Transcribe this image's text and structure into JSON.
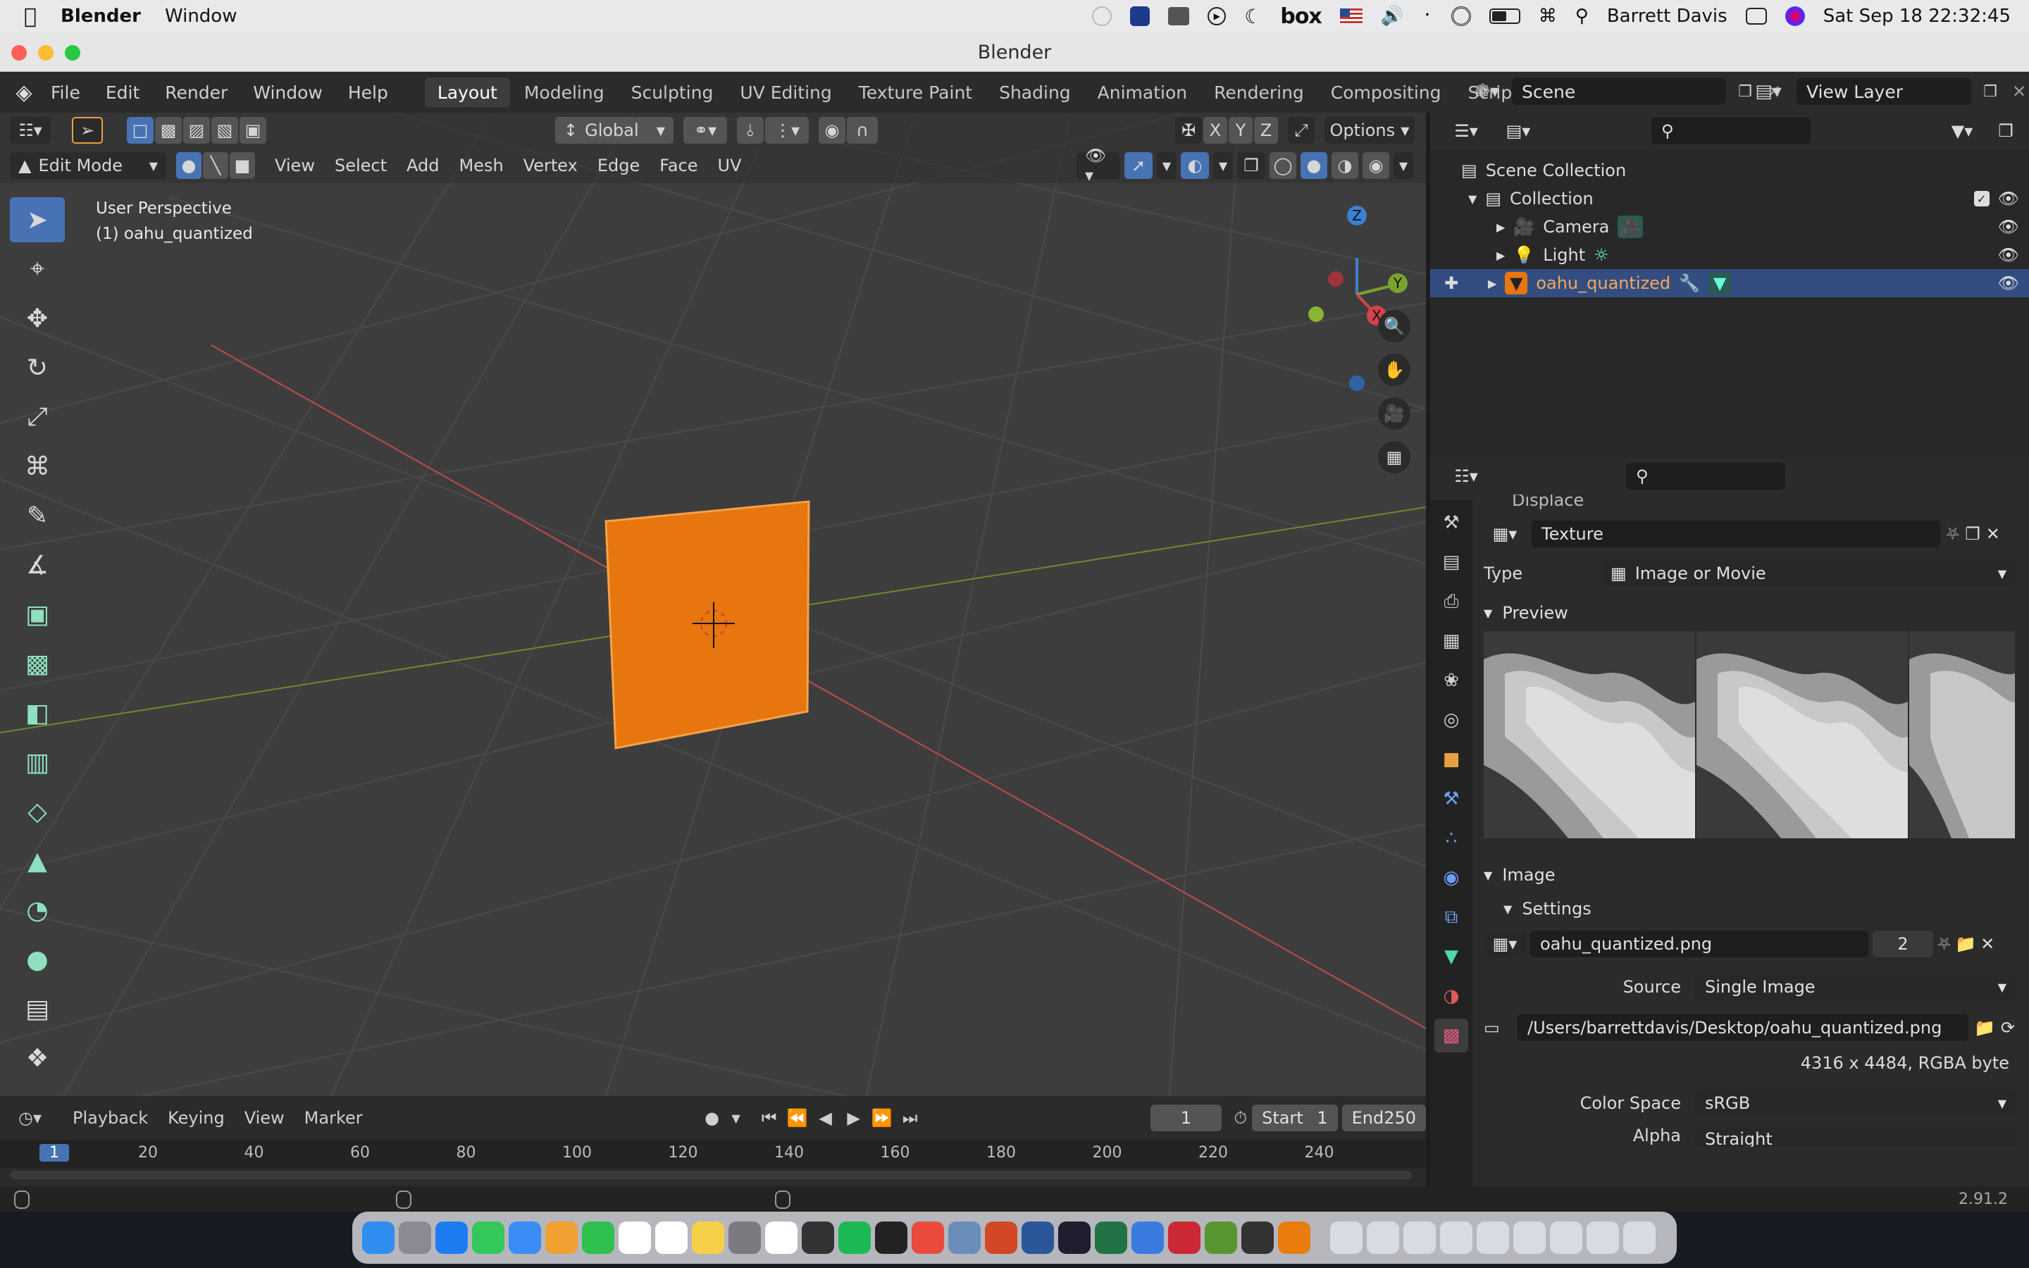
{
  "macos_menubar": {
    "app_name": "Blender",
    "menu_window": "Window",
    "status_icons": [
      "creative-cloud-icon",
      "dropbox-icon",
      "backup-icon",
      "media-play-icon",
      "moon-icon",
      "box-icon",
      "us-flag-icon",
      "volume-icon",
      "bluetooth-icon",
      "airdrop-icon",
      "battery-icon",
      "wifi-icon",
      "spotlight-icon"
    ],
    "box_label": "box",
    "user_name": "Barrett Davis",
    "datetime": "Sat Sep 18  22:32:45"
  },
  "window": {
    "title": "Blender"
  },
  "topbar": {
    "menus": [
      "File",
      "Edit",
      "Render",
      "Window",
      "Help"
    ],
    "workspaces": [
      "Layout",
      "Modeling",
      "Sculpting",
      "UV Editing",
      "Texture Paint",
      "Shading",
      "Animation",
      "Rendering",
      "Compositing",
      "Scripting"
    ],
    "active_workspace": "Layout",
    "add_workspace": "+",
    "scene": "Scene",
    "view_layer": "View Layer"
  },
  "viewport": {
    "header1": {
      "orientation": "Global",
      "axes": [
        "X",
        "Y",
        "Z"
      ],
      "options": "Options"
    },
    "header2": {
      "mode": "Edit Mode",
      "menus": [
        "View",
        "Select",
        "Add",
        "Mesh",
        "Vertex",
        "Edge",
        "Face",
        "UV"
      ]
    },
    "overlay_text": {
      "view_name": "User Perspective",
      "object_name": "(1) oahu_quantized"
    },
    "gizmo": {
      "x": "X",
      "y": "Y",
      "z": "Z"
    },
    "tools": [
      "select-box-icon",
      "cursor-icon",
      "move-icon",
      "rotate-icon",
      "scale-icon",
      "transform-icon",
      "annotate-icon",
      "measure-icon",
      "extrude-region-icon",
      "inset-faces-icon",
      "bevel-icon",
      "loop-cut-icon",
      "knife-icon",
      "poly-build-icon",
      "spin-icon",
      "smooth-icon",
      "edge-slide-icon",
      "shrink-fatten-icon"
    ]
  },
  "timeline": {
    "menus": [
      "Playback",
      "Keying",
      "View",
      "Marker"
    ],
    "current_frame": "1",
    "start_label": "Start",
    "start_value": "1",
    "end_label": "End",
    "end_value": "250",
    "ruler": [
      "1",
      "20",
      "40",
      "60",
      "80",
      "100",
      "120",
      "140",
      "160",
      "180",
      "200",
      "220",
      "240"
    ]
  },
  "statusbar": {
    "version": "2.91.2"
  },
  "outliner": {
    "scene_collection": "Scene Collection",
    "collection": "Collection",
    "items": [
      {
        "name": "Camera"
      },
      {
        "name": "Light"
      },
      {
        "name": "oahu_quantized"
      }
    ]
  },
  "properties": {
    "modifier_name": "Displace",
    "texture_name": "Texture",
    "type_label": "Type",
    "type_value": "Image or Movie",
    "preview_label": "Preview",
    "image_label": "Image",
    "settings_label": "Settings",
    "image_name": "oahu_quantized.png",
    "image_users": "2",
    "source_label": "Source",
    "source_value": "Single Image",
    "filepath": "/Users/barrettdavis/Desktop/oahu_quantized.png",
    "image_info": "4316 x 4484,  RGBA byte",
    "colorspace_label": "Color Space",
    "colorspace_value": "sRGB",
    "alpha_label": "Alpha",
    "alpha_value": "Straight"
  },
  "dock": {
    "apps": [
      {
        "icon": "finder-icon",
        "color": "#2f8ef0"
      },
      {
        "icon": "launchpad-icon",
        "color": "#8a8a95"
      },
      {
        "icon": "safari-icon",
        "color": "#1e7cf2"
      },
      {
        "icon": "messages-icon",
        "color": "#34c759"
      },
      {
        "icon": "mail-icon",
        "color": "#3b8cf5"
      },
      {
        "icon": "photos-icon",
        "color": "#f0a030"
      },
      {
        "icon": "facetime-icon",
        "color": "#30c050"
      },
      {
        "icon": "calendar-icon",
        "color": "#ffffff"
      },
      {
        "icon": "reminders-icon",
        "color": "#ffffff"
      },
      {
        "icon": "notes-icon",
        "color": "#f7d04a"
      },
      {
        "icon": "settings-icon",
        "color": "#7a7a80"
      },
      {
        "icon": "slack-icon",
        "color": "#ffffff"
      },
      {
        "icon": "davinci-icon",
        "color": "#333333"
      },
      {
        "icon": "spotify-icon",
        "color": "#1db954"
      },
      {
        "icon": "terminal-icon",
        "color": "#222222"
      },
      {
        "icon": "appstore-icon",
        "color": "#e94b3c"
      },
      {
        "icon": "preview-icon",
        "color": "#6a8cb8"
      },
      {
        "icon": "powerpoint-icon",
        "color": "#d24726"
      },
      {
        "icon": "word-icon",
        "color": "#2b579a"
      },
      {
        "icon": "vscode-icon",
        "color": "#1e1e2e"
      },
      {
        "icon": "excel-icon",
        "color": "#217346"
      },
      {
        "icon": "chrome-icon",
        "color": "#3a7be0"
      },
      {
        "icon": "zotero-icon",
        "color": "#cc2936"
      },
      {
        "icon": "qgis-icon",
        "color": "#589632"
      },
      {
        "icon": "inkscape-icon",
        "color": "#333333"
      },
      {
        "icon": "blender-icon",
        "color": "#e87d0d"
      },
      {
        "icon": "folder-icon",
        "color": "#d8dce2"
      },
      {
        "icon": "window-icon",
        "color": "#d8dce2"
      },
      {
        "icon": "window-icon",
        "color": "#d8dce2"
      },
      {
        "icon": "window-icon",
        "color": "#d8dce2"
      },
      {
        "icon": "window-icon",
        "color": "#d8dce2"
      },
      {
        "icon": "window-icon",
        "color": "#d8dce2"
      },
      {
        "icon": "window-icon",
        "color": "#d8dce2"
      },
      {
        "icon": "window-icon",
        "color": "#d8dce2"
      },
      {
        "icon": "trash-icon",
        "color": "#d8dce2"
      }
    ]
  },
  "colors": {
    "accent": "#4772b3",
    "selection": "#334d80",
    "object_orange": "#e8760f",
    "outliner_text_selected": "#f0a860"
  }
}
